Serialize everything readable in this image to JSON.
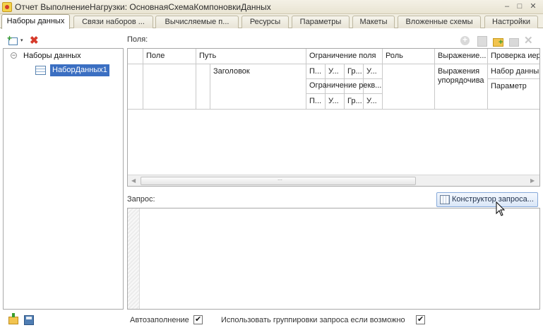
{
  "window": {
    "title": "Отчет ВыполнениеНагрузки: ОсновнаяСхемаКомпоновкиДанных",
    "minimize": "–",
    "maximize": "□",
    "close": "✕"
  },
  "tabs": [
    {
      "label": "Наборы данных",
      "active": true
    },
    {
      "label": "Связи наборов ...",
      "active": false
    },
    {
      "label": "Вычисляемые п...",
      "active": false
    },
    {
      "label": "Ресурсы",
      "active": false
    },
    {
      "label": "Параметры",
      "active": false
    },
    {
      "label": "Макеты",
      "active": false
    },
    {
      "label": "Вложенные схемы",
      "active": false
    },
    {
      "label": "Настройки",
      "active": false
    }
  ],
  "left": {
    "toolbar": {
      "add_icon": "add-dataset-icon",
      "delete_icon": "delete-icon",
      "dropdown_arrow": "▾",
      "delete_glyph": "✖"
    },
    "tree": {
      "expander": "−",
      "root": "Наборы данных",
      "children": [
        {
          "label": "НаборДанных1",
          "selected": true
        }
      ]
    }
  },
  "fields": {
    "label": "Поля:",
    "columns": {
      "field": "Поле",
      "path": "Путь",
      "field_restriction": "Ограничение поля",
      "requisite_restriction": "Ограничение рекв...",
      "role": "Роль",
      "expression": "Выражение...",
      "hierarchy_check": "Проверка иер"
    },
    "subcolumns": [
      "П...",
      "У...",
      "Гр...",
      "У..."
    ],
    "subcolumns2": [
      "П...",
      "У...",
      "Гр...",
      "У..."
    ],
    "row_title": "Заголовок",
    "expression_sub": "Выражения упорядочива",
    "hierarchy_sub1": "Набор данны",
    "hierarchy_sub2": "Параметр",
    "scroll_grip": "⋯"
  },
  "query": {
    "label": "Запрос:",
    "constructor_button": "Конструктор запроса..."
  },
  "options": {
    "autofill": {
      "label": "Автозаполнение",
      "checked": true
    },
    "use_grouping": {
      "label": "Использовать группировки запроса если возможно",
      "checked": true
    }
  }
}
